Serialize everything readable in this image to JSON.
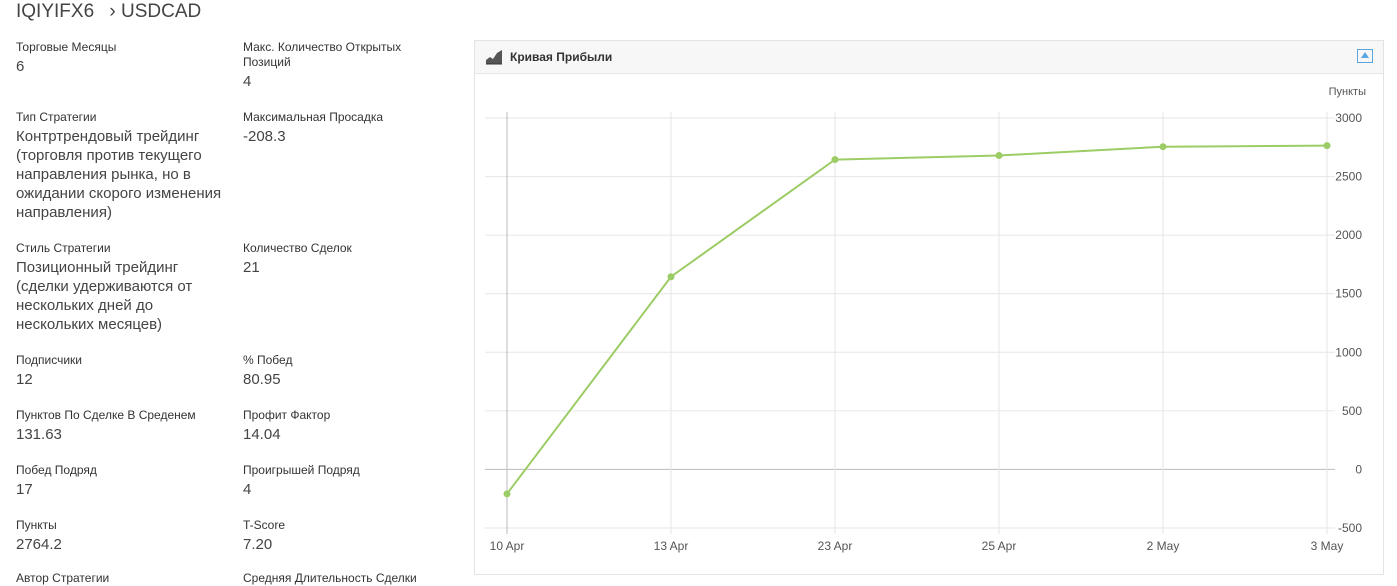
{
  "header": {
    "provider": "IQIYIFX6",
    "separator": "›",
    "symbol": "USDCAD"
  },
  "stats": {
    "trading_months": {
      "label": "Торговые Месяцы",
      "value": "6"
    },
    "max_open_positions": {
      "label": "Макс. Количество Открытых Позиций",
      "value": "4"
    },
    "strategy_type": {
      "label": "Тип Стратегии",
      "value": "Контртрендовый трейдинг (торговля против текущего направления рынка, но в ожидании скорого изменения направления)"
    },
    "max_drawdown": {
      "label": "Максимальная Просадка",
      "value": "-208.3"
    },
    "strategy_style": {
      "label": "Стиль Стратегии",
      "value": "Позиционный трейдинг (сделки удерживаются от нескольких дней до нескольких месяцев)"
    },
    "trades_count": {
      "label": "Количество Сделок",
      "value": "21"
    },
    "subscribers": {
      "label": "Подписчики",
      "value": "12"
    },
    "win_percent": {
      "label": "% Побед",
      "value": "80.95"
    },
    "avg_pips_per_trade": {
      "label": "Пунктов По Сделке В Среденем",
      "value": "131.63"
    },
    "profit_factor": {
      "label": "Профит Фактор",
      "value": "14.04"
    },
    "wins_in_row": {
      "label": "Побед Подряд",
      "value": "17"
    },
    "losses_in_row": {
      "label": "Проигрышей Подряд",
      "value": "4"
    },
    "pips": {
      "label": "Пункты",
      "value": "2764.2"
    },
    "t_score": {
      "label": "T-Score",
      "value": "7.20"
    },
    "strategy_author": {
      "label": "Автор Стратегии",
      "value": ""
    },
    "avg_trade_duration": {
      "label": "Средняя Длительность Сделки",
      "value": ""
    }
  },
  "panel": {
    "title": "Кривая Прибыли"
  },
  "colors": {
    "line": "#9ccc65",
    "grid": "#e6e6e6",
    "zero_line": "#bbbbbb"
  },
  "chart_data": {
    "type": "line",
    "title": "Кривая Прибыли",
    "xlabel": "",
    "ylabel": "Пункты",
    "categories": [
      "10 Apr",
      "13 Apr",
      "23 Apr",
      "25 Apr",
      "2 May",
      "3 May"
    ],
    "series": [
      {
        "values": [
          -208.3,
          1645,
          2645,
          2680,
          2755,
          2764.2
        ]
      }
    ],
    "ylim": [
      -500,
      3000
    ],
    "yticks": [
      -500,
      0,
      500,
      1000,
      1500,
      2000,
      2500,
      3000
    ],
    "y_axis_side": "right",
    "grid": true
  }
}
